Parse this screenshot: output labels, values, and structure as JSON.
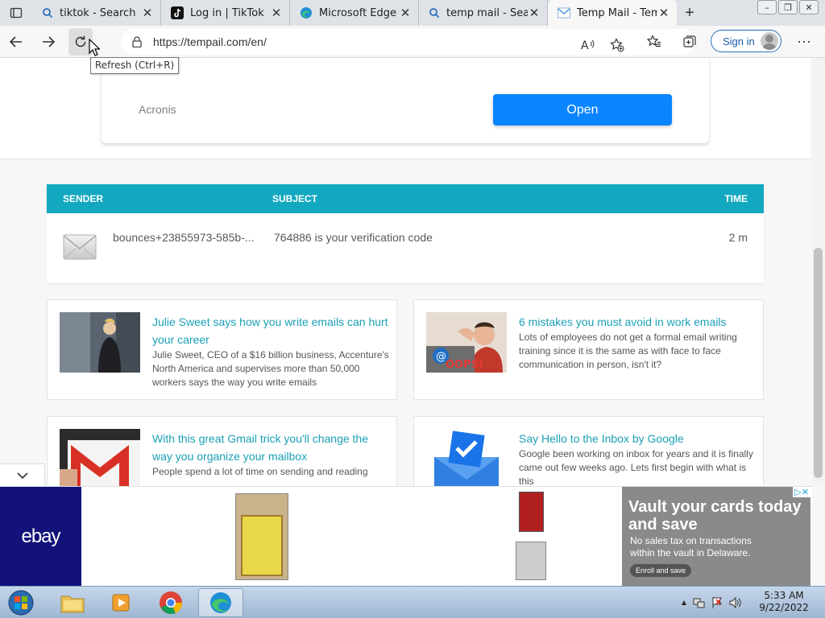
{
  "browser": {
    "tabs": [
      {
        "title": "tiktok - Search",
        "icon": "search-icon",
        "active": false
      },
      {
        "title": "Log in | TikTok",
        "icon": "tiktok-icon",
        "active": false
      },
      {
        "title": "Microsoft Edge",
        "icon": "edge-icon",
        "active": false
      },
      {
        "title": "temp mail - Search",
        "icon": "search-icon",
        "active": false
      },
      {
        "title": "Temp Mail - Temp",
        "icon": "gmail-icon",
        "active": true
      }
    ],
    "url": "https://tempail.com/en/",
    "refresh_tooltip": "Refresh (Ctrl+R)",
    "sign_in_label": "Sign in",
    "more_label": "···"
  },
  "ad_top": {
    "brand": "Acronis",
    "button_label": "Open"
  },
  "inbox": {
    "headers": {
      "sender": "SENDER",
      "subject": "SUBJECT",
      "time": "TIME"
    },
    "messages": [
      {
        "sender": "bounces+23855973-585b-...",
        "subject": "764886 is your verification code",
        "time": "2 m"
      }
    ]
  },
  "articles": [
    {
      "title": "Julie Sweet says how you write emails can hurt your career",
      "summary": "Julie Sweet, CEO of a $16 billion business, Accenture's North America and supervises more than 50,000 workers says the way you write emails"
    },
    {
      "title": "6 mistakes you must avoid in work emails",
      "summary": "Lots of employees do not get a formal email writing training since it is the same as with face to face communication in person, isn't it?",
      "image_text": "OOPS!"
    },
    {
      "title": "With this great Gmail trick you'll change the way you organize your mailbox",
      "summary": "People spend a lot of time on sending and reading"
    },
    {
      "title": "Say Hello to the Inbox by Google",
      "summary": "Google been working on inbox for years and it is finally came out few weeks ago. Lets first begin with what is this"
    }
  ],
  "banner_ad": {
    "brand": "ebay",
    "headline": "Vault your cards today and save",
    "sub": "No sales tax on transactions within the vault in Delaware.",
    "cta": "Enroll and save"
  },
  "taskbar": {
    "apps": [
      "explorer-icon",
      "media-player-icon",
      "chrome-icon",
      "edge-icon"
    ],
    "time": "5:33 AM",
    "date": "9/22/2022"
  },
  "colors": {
    "accent_teal": "#12a8c0",
    "link_teal": "#1aa0b5",
    "open_blue": "#0a84ff",
    "ebay_navy": "#12127a"
  }
}
